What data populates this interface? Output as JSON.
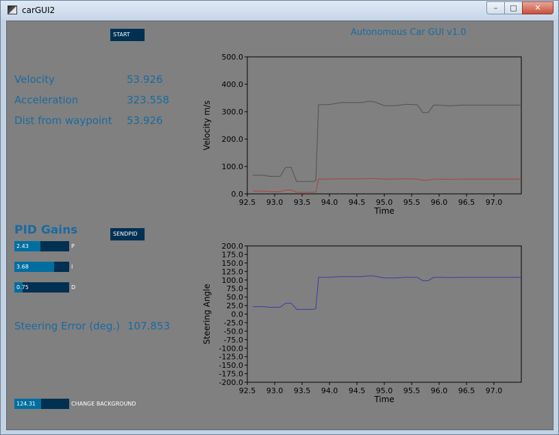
{
  "window": {
    "title": "carGUI2",
    "minimize_glyph": "–",
    "maximize_glyph": "□",
    "close_glyph": "✕"
  },
  "app": {
    "title": "Autonomous Car GUI v1.0",
    "start_label": "START",
    "sendpid_label": "SENDPID"
  },
  "readouts": {
    "velocity_label": "Velocity",
    "velocity_value": "53.926",
    "acceleration_label": "Acceleration",
    "acceleration_value": "323.558",
    "dist_label": "Dist from waypoint",
    "dist_value": "53.926",
    "steering_error_label": "Steering Error (deg.)",
    "steering_error_value": "107.853"
  },
  "pid": {
    "heading": "PID Gains",
    "sliders": [
      {
        "value_text": "2.43",
        "caption": "P",
        "fill_fraction": 0.48
      },
      {
        "value_text": "3.68",
        "caption": "I",
        "fill_fraction": 0.73
      },
      {
        "value_text": "0.75",
        "caption": "D",
        "fill_fraction": 0.15
      }
    ]
  },
  "background_slider": {
    "value_text": "124.31",
    "caption": "CHANGE BACKGROUND",
    "fill_fraction": 0.49
  },
  "colors": {
    "accent": "#1a6aa0",
    "control_bg": "#003052",
    "control_fill": "#016ea0",
    "panel_bg": "#808080"
  },
  "chart_data": [
    {
      "type": "line",
      "xlabel": "Time",
      "ylabel": "Velocity m/s",
      "xlim": [
        92.5,
        97.5
      ],
      "ylim": [
        0,
        500
      ],
      "xticks": [
        "92.5",
        "93.0",
        "93.5",
        "94.0",
        "94.5",
        "95.0",
        "95.5",
        "96.0",
        "96.5",
        "97.0"
      ],
      "yticks": [
        "0.0",
        "100.0",
        "200.0",
        "300.0",
        "400.0",
        "500.0"
      ],
      "series": [
        {
          "color": "#505050",
          "x": [
            92.6,
            92.8,
            92.9,
            93.1,
            93.2,
            93.3,
            93.4,
            93.7,
            93.75,
            93.8,
            94.0,
            94.2,
            94.4,
            94.6,
            94.7,
            94.8,
            95.0,
            95.2,
            95.4,
            95.6,
            95.7,
            95.8,
            95.9,
            96.0,
            96.2,
            96.4,
            96.6,
            96.8,
            97.0,
            97.5
          ],
          "y": [
            68,
            68,
            64,
            64,
            97,
            97,
            45,
            45,
            48,
            325,
            326,
            333,
            333,
            333,
            338,
            337,
            322,
            322,
            327,
            325,
            297,
            297,
            324,
            324,
            321,
            324,
            324,
            324,
            324,
            324
          ]
        },
        {
          "color": "#b03c3c",
          "x": [
            92.6,
            92.8,
            92.9,
            93.1,
            93.2,
            93.3,
            93.4,
            93.7,
            93.75,
            93.8,
            94.0,
            94.2,
            94.4,
            94.6,
            94.7,
            94.8,
            95.0,
            95.2,
            95.4,
            95.6,
            95.7,
            95.8,
            95.9,
            96.0,
            96.2,
            96.4,
            96.6,
            96.8,
            97.0,
            97.5
          ],
          "y": [
            10,
            10,
            8,
            8,
            14,
            14,
            6,
            6,
            7,
            54,
            54,
            55,
            55,
            55,
            56,
            56,
            54,
            54,
            55,
            54,
            50,
            50,
            54,
            54,
            53,
            54,
            54,
            54,
            54,
            54
          ]
        }
      ]
    },
    {
      "type": "line",
      "xlabel": "Time",
      "ylabel": "Steering Angle",
      "xlim": [
        92.5,
        97.5
      ],
      "ylim": [
        -200,
        200
      ],
      "xticks": [
        "92.5",
        "93.0",
        "93.5",
        "94.0",
        "94.5",
        "95.0",
        "95.5",
        "96.0",
        "96.5",
        "97.0"
      ],
      "yticks": [
        "-200.0",
        "-175.0",
        "-150.0",
        "-125.0",
        "-100.0",
        "-75.0",
        "-50.0",
        "-25.0",
        "0.0",
        "25.0",
        "50.0",
        "75.0",
        "100.0",
        "125.0",
        "150.0",
        "175.0",
        "200.0"
      ],
      "series": [
        {
          "color": "#3a3aa8",
          "x": [
            92.6,
            92.8,
            92.9,
            93.1,
            93.2,
            93.3,
            93.4,
            93.7,
            93.75,
            93.8,
            94.0,
            94.2,
            94.4,
            94.6,
            94.7,
            94.8,
            95.0,
            95.2,
            95.4,
            95.6,
            95.7,
            95.8,
            95.9,
            96.0,
            96.2,
            96.4,
            96.6,
            96.8,
            97.0,
            97.5
          ],
          "y": [
            22,
            22,
            20,
            20,
            32,
            32,
            14,
            14,
            16,
            108,
            108,
            110,
            110,
            110,
            112,
            112,
            106,
            106,
            108,
            108,
            98,
            98,
            108,
            108,
            107,
            108,
            108,
            108,
            108,
            108
          ]
        }
      ]
    }
  ]
}
